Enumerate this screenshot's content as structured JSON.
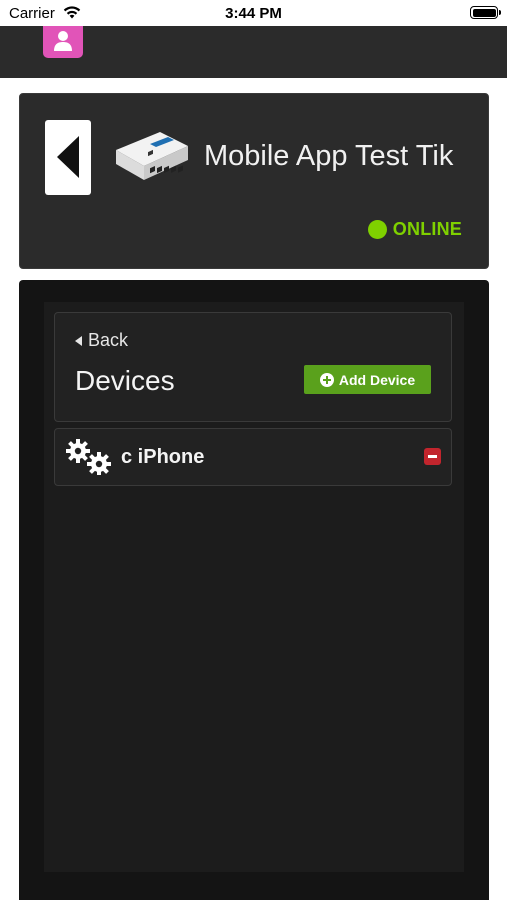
{
  "status_bar": {
    "carrier": "Carrier",
    "time": "3:44 PM"
  },
  "app_bar": {
    "profile_icon": "user-icon",
    "accent_color": "#e154b8"
  },
  "device_card": {
    "name": "Mobile App Test Tik",
    "status": "ONLINE",
    "status_color": "#7fd000",
    "back_icon": "chevron-left-icon",
    "image": "router-image"
  },
  "devices_panel": {
    "back_label": "Back",
    "title": "Devices",
    "add_button_label": "Add Device",
    "add_button_color": "#5aa11c",
    "devices": [
      {
        "name": "c iPhone",
        "icon": "gears-icon",
        "remove_icon": "minus-icon",
        "remove_color": "#c2252d"
      }
    ]
  }
}
